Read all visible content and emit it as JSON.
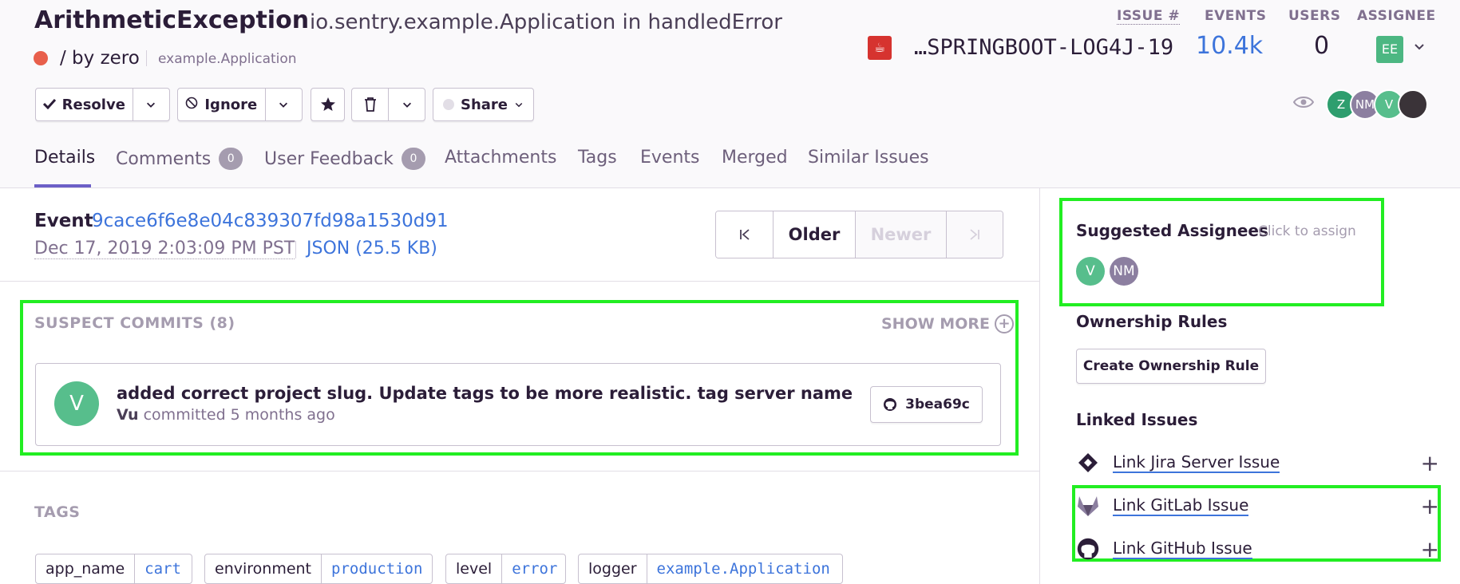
{
  "issue": {
    "title": "ArithmeticException",
    "culprit": "io.sentry.example.Application in handledError",
    "subtitle": "/ by zero",
    "location": "example.Application"
  },
  "stats": {
    "issue_label": "ISSUE #",
    "events_label": "EVENTS",
    "users_label": "USERS",
    "assignee_label": "ASSIGNEE",
    "short_id": "…SPRINGBOOT-LOG4J-19",
    "events": "10.4k",
    "users": "0",
    "assignee_initials": "EE"
  },
  "actions": {
    "resolve": "Resolve",
    "ignore": "Ignore",
    "share": "Share"
  },
  "participants": [
    "Z",
    "NM",
    "V"
  ],
  "tabs": [
    {
      "label": "Details"
    },
    {
      "label": "Comments",
      "badge": "0"
    },
    {
      "label": "User Feedback",
      "badge": "0"
    },
    {
      "label": "Attachments"
    },
    {
      "label": "Tags"
    },
    {
      "label": "Events"
    },
    {
      "label": "Merged"
    },
    {
      "label": "Similar Issues"
    }
  ],
  "event": {
    "label": "Event",
    "id": "9cace6f6e8e04c839307fd98a1530d91",
    "date": "Dec 17, 2019 2:03:09 PM PST",
    "json": "JSON (25.5 KB)",
    "older": "Older",
    "newer": "Newer"
  },
  "suspect_commits": {
    "title": "SUSPECT COMMITS (8)",
    "show_more": "SHOW MORE",
    "commit": {
      "avatar": "V",
      "message": "added correct project slug. Update tags to be more realistic. tag server name",
      "author": "Vu",
      "when": "committed 5 months ago",
      "sha": "3bea69c"
    }
  },
  "tags_section": {
    "title": "TAGS",
    "tags": [
      {
        "key": "app_name",
        "value": "cart"
      },
      {
        "key": "environment",
        "value": "production"
      },
      {
        "key": "level",
        "value": "error"
      },
      {
        "key": "logger",
        "value": "example.Application"
      }
    ]
  },
  "sidebar": {
    "suggested_title": "Suggested Assignees",
    "suggested_hint": "Click to assign",
    "suggested": [
      "V",
      "NM"
    ],
    "ownership_title": "Ownership Rules",
    "create_rule": "Create Ownership Rule",
    "linked_title": "Linked Issues",
    "links": [
      {
        "label": "Link Jira Server Issue",
        "icon": "jira-icon"
      },
      {
        "label": "Link GitLab Issue",
        "icon": "gitlab-icon"
      },
      {
        "label": "Link GitHub Issue",
        "icon": "github-icon"
      }
    ]
  },
  "colors": {
    "accent": "#6c5fc7",
    "link": "#3d74db",
    "error": "#e85f4b",
    "highlight": "#22ee22"
  }
}
